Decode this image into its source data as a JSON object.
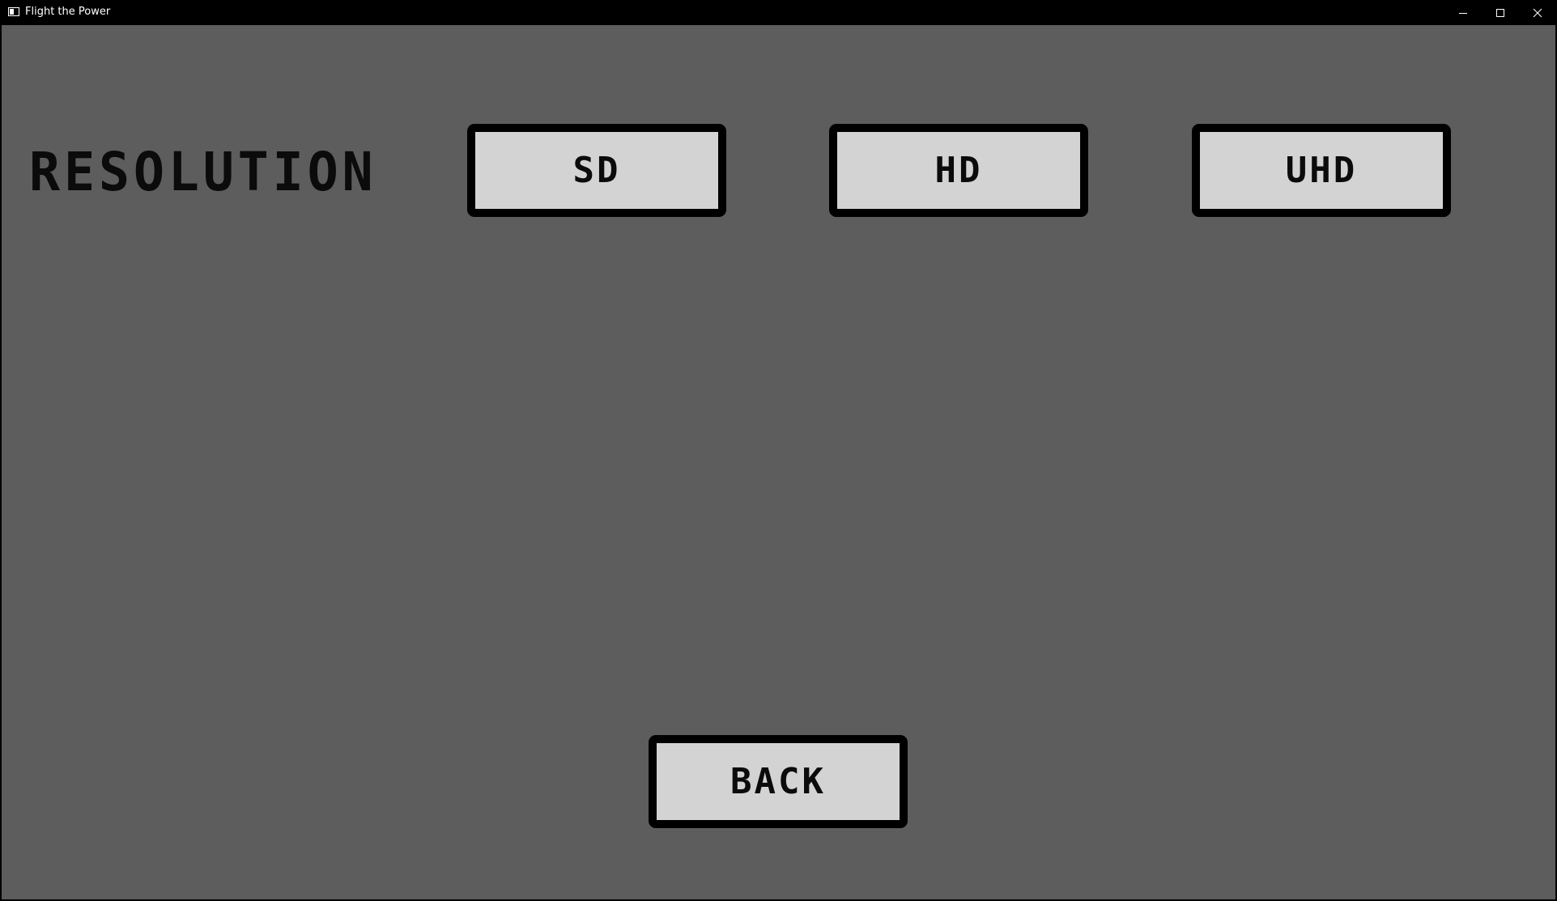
{
  "window": {
    "title": "Flight the Power",
    "icon": "app-window-icon",
    "controls": {
      "minimize_icon": "minimize-icon",
      "maximize_icon": "maximize-icon",
      "close_icon": "close-icon"
    }
  },
  "settings": {
    "resolution_label": "RESOLUTION",
    "options": {
      "sd": "SD",
      "hd": "HD",
      "uhd": "UHD"
    },
    "back_label": "BACK"
  },
  "colors": {
    "background": "#5d5d5d",
    "button_fill": "#d3d3d3",
    "button_border": "#000000",
    "text": "#0b0b0b"
  }
}
